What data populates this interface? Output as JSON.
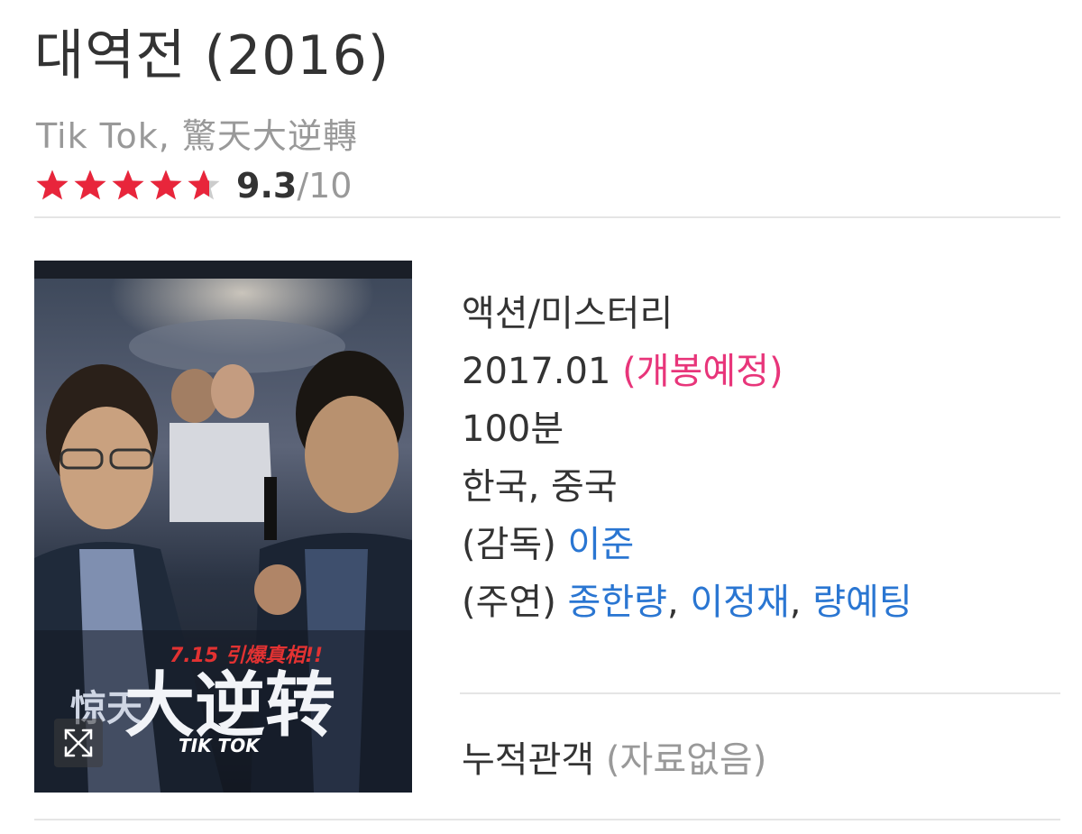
{
  "movie": {
    "title": "대역전 (2016)",
    "alt_titles": "Tik Tok, 驚天大逆轉",
    "rating": {
      "stars_filled": 4.65,
      "stars_total": 5,
      "score": "9.3",
      "max": "/10",
      "star_color": "#e8253b",
      "star_empty_color": "#cccccc"
    }
  },
  "details": {
    "genre": "액션/미스터리",
    "release_date": "2017.01",
    "release_status": "(개봉예정)",
    "runtime": "100분",
    "country": "한국, 중국",
    "director_label": "(감독)",
    "director": "이준",
    "cast_label": "(주연)",
    "cast": [
      "종한량",
      "이정재",
      "량예팅"
    ],
    "separator": ","
  },
  "audience": {
    "label": "누적관객",
    "value": "(자료없음)"
  },
  "poster": {
    "headline": "大逆转",
    "prefix": "惊天",
    "english_title": "TIK TOK",
    "tagline": "7.15 引爆真相!!",
    "expand_icon": "expand-arrows-icon"
  },
  "colors": {
    "accent_pink": "#e8357a",
    "link_blue": "#2a76d2",
    "muted": "#999999"
  }
}
